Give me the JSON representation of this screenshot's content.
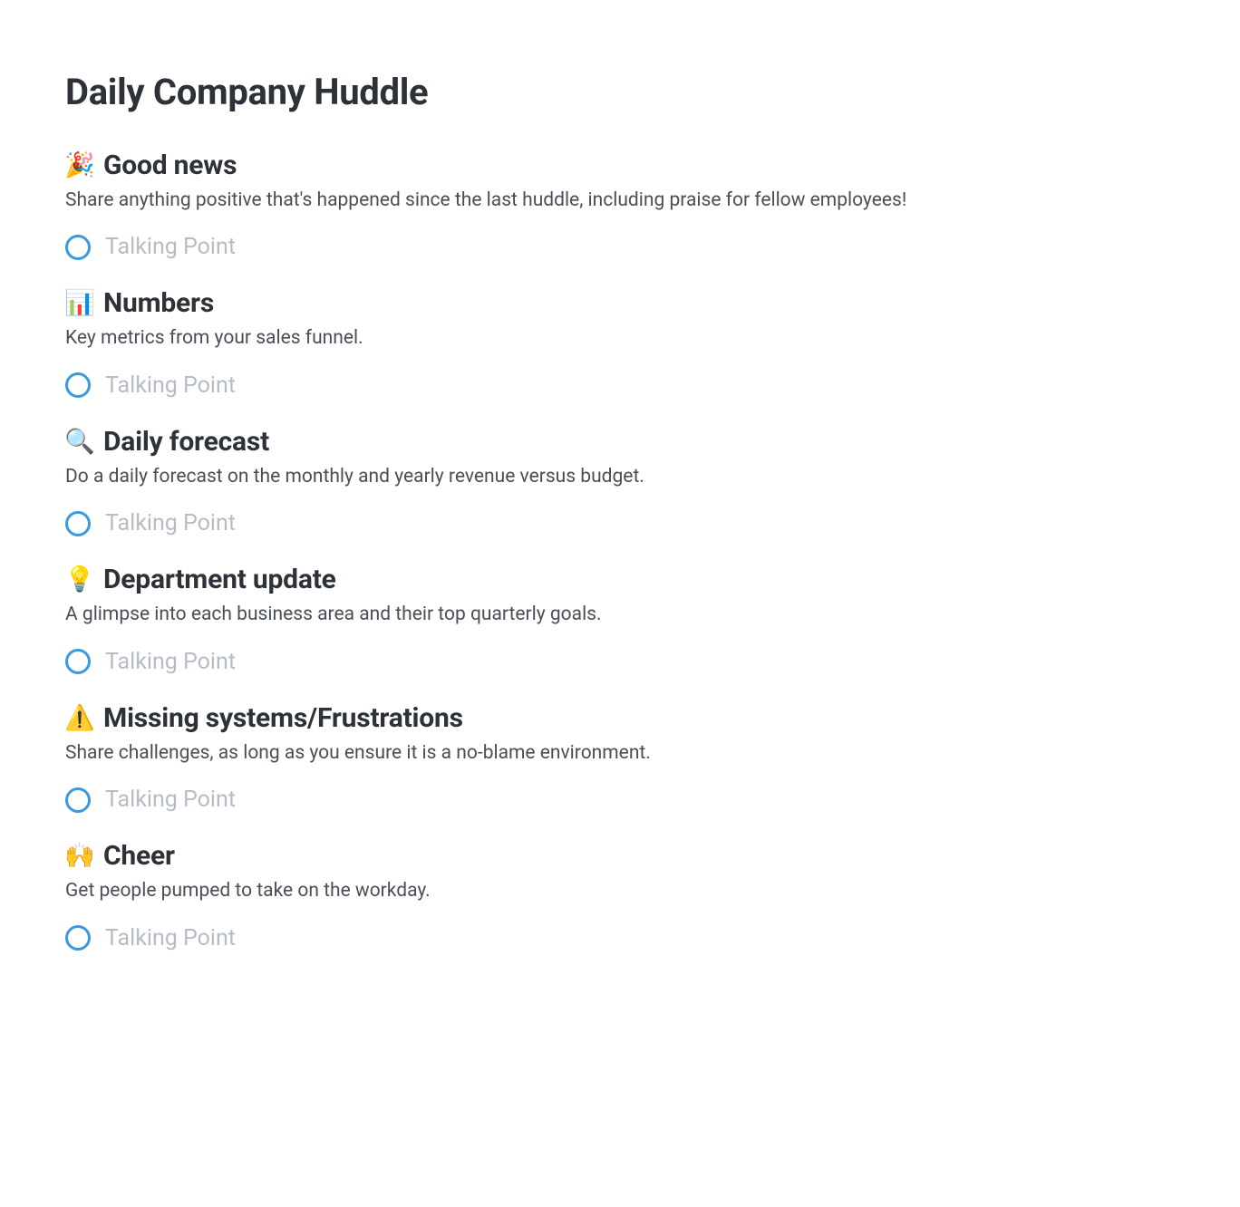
{
  "title": "Daily Company Huddle",
  "talking_point_placeholder": "Talking Point",
  "sections": [
    {
      "icon": "🎉",
      "title": "Good news",
      "desc": "Share anything positive that's happened since the last huddle, including praise for fellow employees!"
    },
    {
      "icon": "📊",
      "title": "Numbers",
      "desc": "Key metrics from your sales funnel."
    },
    {
      "icon": "🔍",
      "title": "Daily forecast",
      "desc": "Do a daily forecast on the monthly and yearly revenue versus budget."
    },
    {
      "icon": "💡",
      "title": "Department update",
      "desc": "A glimpse into each business area and their top quarterly goals."
    },
    {
      "icon": "⚠️",
      "title": "Missing systems/Frustrations",
      "desc": "Share challenges, as long as you ensure it is a no-blame environment."
    },
    {
      "icon": "🙌",
      "title": "Cheer",
      "desc": "Get people pumped to take on the workday."
    }
  ]
}
